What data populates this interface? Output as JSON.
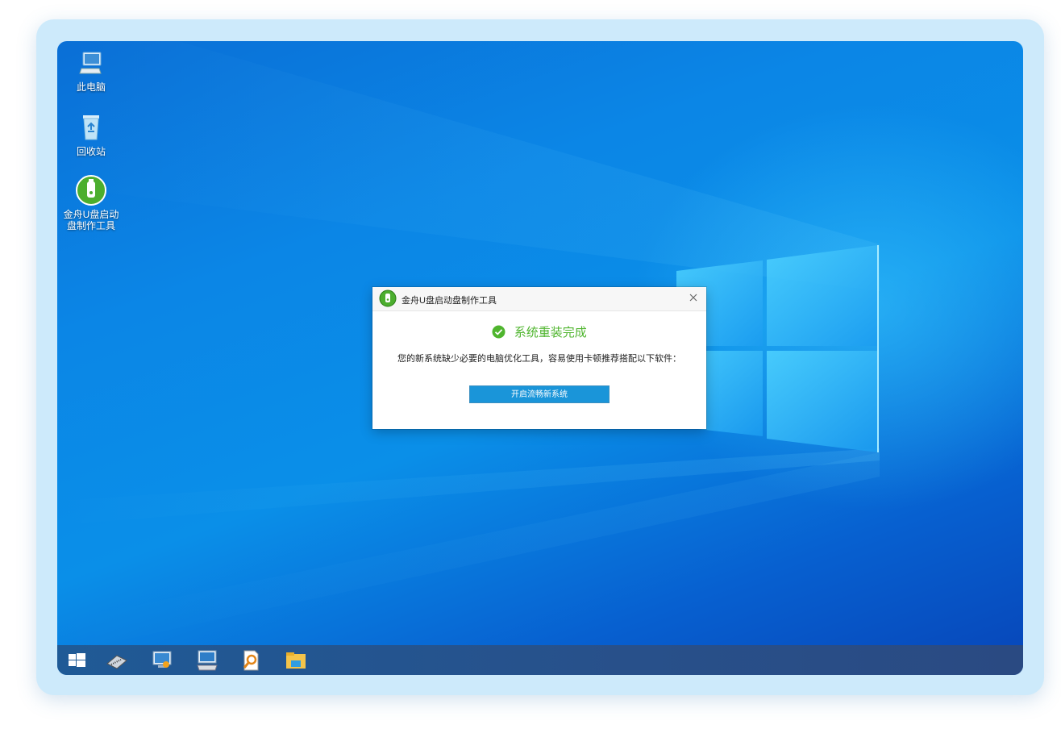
{
  "desktop": {
    "icons": [
      {
        "label": "此电脑",
        "icon": "computer-icon"
      },
      {
        "label": "回收站",
        "icon": "recycle-bin-icon"
      },
      {
        "label": "金舟U盘启动盘制作工具",
        "icon": "usb-tool-icon"
      }
    ]
  },
  "dialog": {
    "title": "金舟U盘启动盘制作工具",
    "status": "系统重装完成",
    "message": "您的新系统缺少必要的电脑优化工具，容易使用卡顿推荐搭配以下软件：",
    "button_label": "开启流畅新系统",
    "status_color": "#4fb52e"
  },
  "taskbar": {
    "items": [
      "windows-start-icon",
      "hard-drive-icon",
      "monitor-tool-icon",
      "keyboard-monitor-icon",
      "search-document-icon",
      "file-explorer-icon"
    ]
  },
  "colors": {
    "accent": "#1a95d9",
    "desktop": "#0a86e6"
  }
}
